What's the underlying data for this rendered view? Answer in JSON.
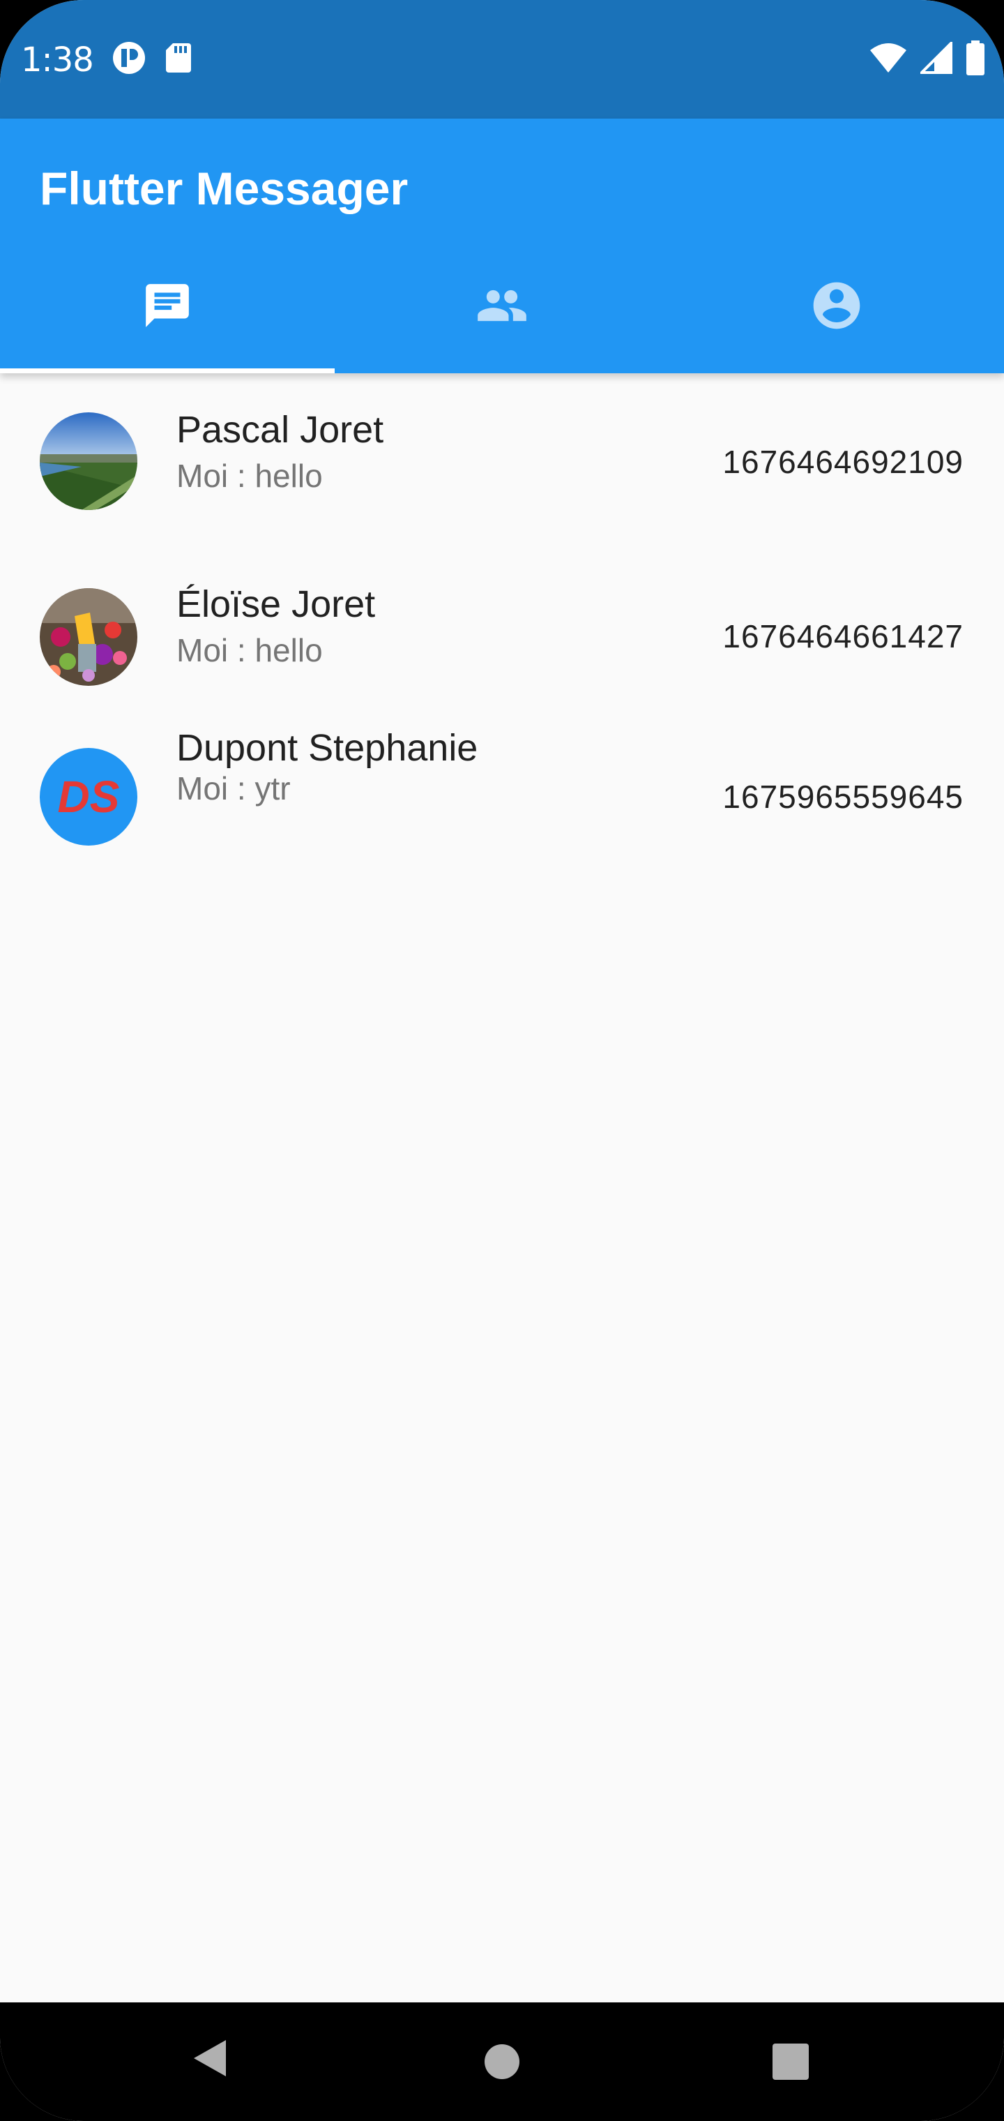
{
  "status_bar": {
    "time": "1:38",
    "left_icons": [
      "app-notification-icon",
      "sd-card-icon"
    ],
    "right_icons": [
      "wifi-icon",
      "cell-signal-icon",
      "battery-icon"
    ]
  },
  "app_bar": {
    "title": "Flutter Messager",
    "background": "#2196f3",
    "status_background": "#1a72b9"
  },
  "tabs": [
    {
      "icon": "chat-message-icon",
      "active": true
    },
    {
      "icon": "people-group-icon",
      "active": false
    },
    {
      "icon": "account-circle-icon",
      "active": false
    }
  ],
  "conversations": [
    {
      "name": "Pascal Joret",
      "last_message": "Moi : hello",
      "timestamp": "1676464692109",
      "avatar": "photo-landscape"
    },
    {
      "name": "Éloïse  Joret",
      "last_message": "Moi : hello",
      "timestamp": "1676464661427",
      "avatar": "photo-flowers"
    },
    {
      "name": "Dupont Stephanie",
      "last_message": "Moi : ytr",
      "timestamp": "1675965559645",
      "avatar": "initials",
      "initials": "DS",
      "initials_color": "#e53935",
      "avatar_bg": "#2196f3"
    }
  ],
  "nav_bar": {
    "buttons": [
      "back-icon",
      "home-icon",
      "recents-icon"
    ]
  }
}
